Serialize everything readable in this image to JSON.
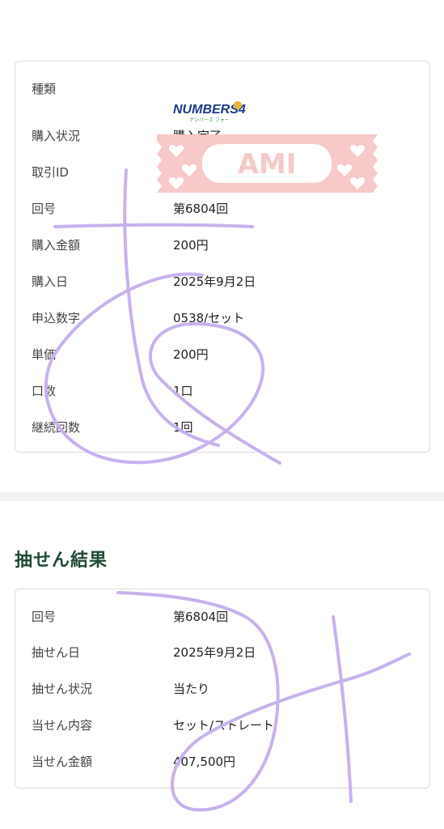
{
  "purchase": {
    "logo_text": "NUMBERS4",
    "logo_sub": "ナンバーズ フォー",
    "rows": [
      {
        "label": "種類",
        "value": ""
      },
      {
        "label": "購入状況",
        "value": "購入完了"
      },
      {
        "label": "取引ID",
        "value": ""
      },
      {
        "label": "回号",
        "value": "第6804回"
      },
      {
        "label": "購入金額",
        "value": "200円"
      },
      {
        "label": "購入日",
        "value": "2025年9月2日"
      },
      {
        "label": "申込数字",
        "value": "0538/セット"
      },
      {
        "label": "単価",
        "value": "200円"
      },
      {
        "label": "口数",
        "value": "1口"
      },
      {
        "label": "継続回数",
        "value": "1回"
      }
    ]
  },
  "result": {
    "title": "抽せん結果",
    "rows": [
      {
        "label": "回号",
        "value": "第6804回"
      },
      {
        "label": "抽せん日",
        "value": "2025年9月2日"
      },
      {
        "label": "抽せん状況",
        "value": "当たり"
      },
      {
        "label": "当せん内容",
        "value": "セット/ストレート"
      },
      {
        "label": "当せん金額",
        "value": "407,500円"
      }
    ]
  },
  "sticker": {
    "text": "AMI",
    "color": "#f7c9c9"
  },
  "colors": {
    "title": "#1f4a35",
    "scribble": "#c7b2ee",
    "logo_blue": "#1b3a8c",
    "logo_green": "#3c9a3c"
  }
}
